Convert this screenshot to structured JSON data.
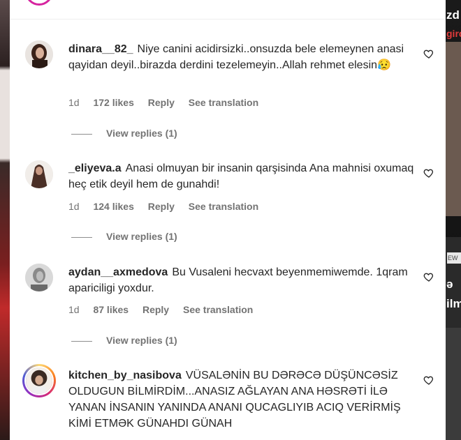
{
  "colors": {
    "text": "#262626",
    "muted": "#737373",
    "background": "#ffffff",
    "story_ring": "#d62976"
  },
  "background_right": {
    "fragments": [
      "zd",
      "girc",
      "ə",
      "ilm",
      "EW"
    ]
  },
  "comments": [
    {
      "username": "dinara__82_",
      "text": "Niye canini acidirsizki..onsuzda bele elemeynen anasi qayidan deyil..birazda derdini tezelemeyin..Allah rehmet elesin😥",
      "time": "1d",
      "likes": "172 likes",
      "reply": "Reply",
      "translate": "See translation",
      "view_replies": "View replies (1)",
      "icon": "heart-icon"
    },
    {
      "username": "_eliyeva.a",
      "text": "Anasi olmuyan bir insanin qarşisinda Ana mahnisi oxumaq heç etik deyil hem de gunahdi!",
      "time": "1d",
      "likes": "124 likes",
      "reply": "Reply",
      "translate": "See translation",
      "view_replies": "View replies (1)",
      "icon": "heart-icon"
    },
    {
      "username": "aydan__axmedova",
      "text": "Bu Vusaleni hecvaxt beyenmemiwemde. 1qram apariciligi yoxdur.",
      "time": "1d",
      "likes": "87 likes",
      "reply": "Reply",
      "translate": "See translation",
      "view_replies": "View replies (1)",
      "icon": "heart-icon"
    },
    {
      "username": "kitchen_by_nasibova",
      "text": "VÜSALƏNİN BU DƏRƏCƏ DÜŞÜNCƏSİZ OLDUGUN BİLMİRDİM...ANASIZ AĞLAYAN ANA HƏSRƏTİ İLƏ YANAN İNSANIN YANINDA ANANI QUCAGLIYIB ACIQ VERİRMİŞ KİMİ ETMƏK GÜNAHDI GÜNAH",
      "icon": "heart-icon"
    }
  ]
}
